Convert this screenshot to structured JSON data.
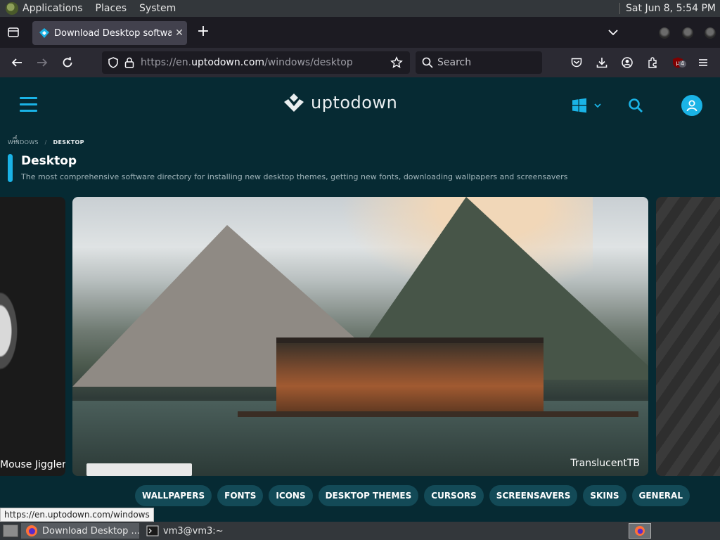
{
  "top_panel": {
    "menu_applications": "Applications",
    "menu_places": "Places",
    "menu_system": "System",
    "clock": "Sat Jun  8,  5:54 PM"
  },
  "browser": {
    "tab_title": "Download Desktop software",
    "url_prefix": "https://en.",
    "url_host": "uptodown.com",
    "url_path": "/windows/desktop",
    "search_placeholder": "Search",
    "extension_badge": "4",
    "status_url": "https://en.uptodown.com/windows"
  },
  "site": {
    "logo_text": "uptodown",
    "breadcrumb_parent": "WINDOWS",
    "breadcrumb_sep": "/",
    "breadcrumb_current": "DESKTOP",
    "page_title": "Desktop",
    "page_description": "The most comprehensive software directory for installing new desktop themes, getting new fonts, downloading wallpapers and screensavers",
    "carousel": {
      "left_label": "Mouse Jiggler",
      "main_label": "TranslucentTB"
    },
    "categories": [
      "WALLPAPERS",
      "FONTS",
      "ICONS",
      "DESKTOP THEMES",
      "CURSORS",
      "SCREENSAVERS",
      "SKINS",
      "GENERAL"
    ],
    "colors": {
      "accent": "#1ab3e6",
      "background": "#062a33",
      "pill": "#134a57"
    }
  },
  "taskbar": {
    "firefox_item": "Download Desktop ...",
    "terminal_item": "vm3@vm3:~"
  },
  "icons": [
    "apps-icon",
    "tab-list-icon",
    "uptodown-favicon",
    "close-icon",
    "plus-icon",
    "chevron-down-icon",
    "back-arrow-icon",
    "forward-arrow-icon",
    "reload-icon",
    "shield-icon",
    "lock-icon",
    "star-icon",
    "search-icon",
    "pocket-icon",
    "download-icon",
    "account-icon",
    "extensions-icon",
    "ublock-icon",
    "menu-icon",
    "windows-icon",
    "user-icon",
    "firefox-icon",
    "terminal-icon"
  ]
}
